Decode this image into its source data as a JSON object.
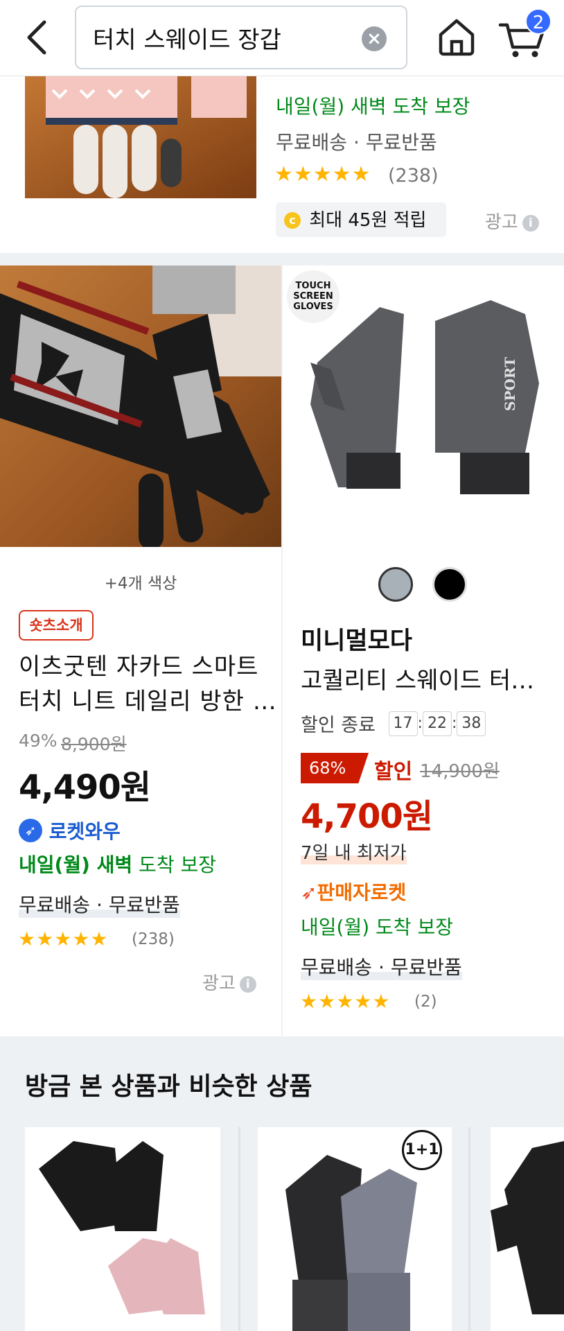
{
  "header": {
    "search_value": "터치 스웨이드 장갑",
    "clear_icon": "×",
    "cart_count": "2"
  },
  "top_card": {
    "delivery": "내일(월) 새벽 도착 보장",
    "shipping": "무료배송 · 무료반품",
    "stars": "★★★★★",
    "review_count": "(238)",
    "reward": "최대 45원 적립",
    "ad_label": "광고"
  },
  "left_card": {
    "color_count": "+4개 색상",
    "badge": "숏츠소개",
    "title_line1": "이츠굿텐 자카드 스마트",
    "title_line2": "터치 니트 데일리 방한 …",
    "discount_pct": "49%",
    "original_price": "8,900원",
    "price": "4,490원",
    "rocket_label": "로켓와우",
    "delivery_bold": "내일(월) 새벽",
    "delivery_rest": " 도착 보장",
    "shipping": "무료배송 · 무료반품",
    "stars": "★★★★★",
    "review_count": "(238)",
    "ad_label": "광고"
  },
  "right_card": {
    "image_badge_l1": "TOUCH",
    "image_badge_l2": "SCREEN",
    "image_badge_l3": "GLOVES",
    "brand": "미니멀모다",
    "title": "고퀄리티 스웨이드 터…",
    "sale_end_label": "할인 종료",
    "timer_h": "17",
    "timer_m": "22",
    "timer_s": "38",
    "discount_pct": "68%",
    "discount_word": "할인",
    "original_price": "14,900원",
    "price": "4,700원",
    "lowest_label": "7일 내 최저가",
    "rocket_label": "판매자로켓",
    "delivery": "내일(월) 도착 보장",
    "shipping": "무료배송 · 무료반품",
    "stars": "★★★★★",
    "review_count": "(2)",
    "swatch_colors": [
      "#a8b0b8",
      "#000000"
    ]
  },
  "similar": {
    "heading": "방금 본 상품과 비슷한 상품",
    "badge_1plus1": "1+1"
  },
  "colors": {
    "accent_blue": "#346aff",
    "sale_red": "#cc1a00",
    "delivery_green": "#00891a",
    "star_yellow": "#ffb400"
  }
}
